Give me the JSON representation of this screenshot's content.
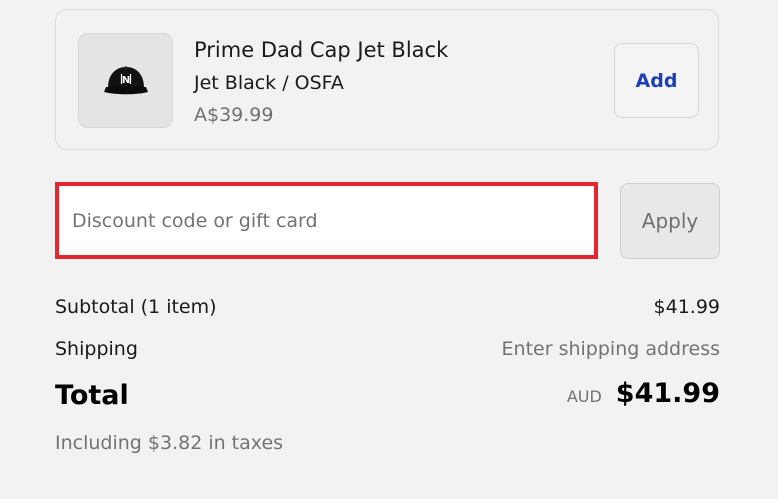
{
  "product": {
    "name": "Prime Dad Cap Jet Black",
    "variant": "Jet Black / OSFA",
    "price": "A$39.99",
    "image_icon": "cap-icon",
    "add_label": "Add"
  },
  "discount": {
    "placeholder": "Discount code or gift card",
    "value": "",
    "apply_label": "Apply",
    "highlight_color": "#e4262e"
  },
  "summary": {
    "subtotal_label": "Subtotal (1 item)",
    "subtotal_value": "$41.99",
    "shipping_label": "Shipping",
    "shipping_value": "Enter shipping address",
    "total_label": "Total",
    "currency": "AUD",
    "total_value": "$41.99",
    "taxes_note": "Including $3.82 in taxes"
  },
  "colors": {
    "add_text": "#1f3fb5",
    "background": "#f2f2f2"
  }
}
